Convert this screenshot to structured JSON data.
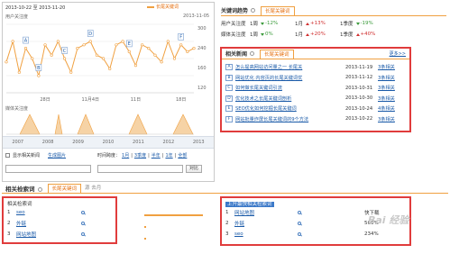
{
  "chart": {
    "date_range": "2013-10-22 至 2013-11-20",
    "legend_keyword": "长尾关键词",
    "end_date": "2013-11-05",
    "user_index_label": "用户关注度",
    "media_index_label": "媒体关注度",
    "point_markers": [
      "A",
      "B",
      "C",
      "D",
      "E",
      "F"
    ],
    "x_ticks": [
      "28日",
      "11月4日",
      "11日",
      "18日"
    ],
    "y_ticks": [
      "300",
      "240",
      "160",
      "120"
    ],
    "timeline_years": [
      "2007",
      "2008",
      "2009",
      "2010",
      "2011",
      "2012",
      "2013"
    ],
    "show_related_news": "显示相关新闻",
    "generate_image": "生成图片",
    "time_span_label": "时间跨度：",
    "span_options": [
      "1月",
      "3季度",
      "半年",
      "1年",
      "全部"
    ],
    "compare_button": "对比"
  },
  "chart_data": {
    "type": "line",
    "title": "",
    "series": [
      {
        "name": "长尾关键词",
        "values": [
          190,
          250,
          160,
          230,
          200,
          150,
          240,
          210,
          250,
          200,
          160,
          230,
          240,
          250,
          210,
          200,
          170,
          240,
          250,
          220,
          180,
          240,
          230,
          210,
          190,
          250,
          200,
          240,
          220,
          230
        ]
      }
    ],
    "ylim": [
      100,
      300
    ],
    "grid": true
  },
  "trend": {
    "title": "关键词趋势",
    "tab": "长尾关键词",
    "rows": [
      {
        "label": "用户关注度",
        "cells": [
          {
            "period": "1周",
            "dir": "down",
            "val": "-12%"
          },
          {
            "period": "1月",
            "dir": "up",
            "val": "+13%"
          },
          {
            "period": "1季度",
            "dir": "down",
            "val": "-19%"
          }
        ]
      },
      {
        "label": "媒体关注度",
        "cells": [
          {
            "period": "1周",
            "dir": "down",
            "val": "0%"
          },
          {
            "period": "1月",
            "dir": "up",
            "val": "+20%"
          },
          {
            "period": "1季度",
            "dir": "up",
            "val": "+40%"
          }
        ]
      }
    ]
  },
  "news": {
    "title": "相关新闻",
    "tab": "长尾关键词",
    "more": "更多>>",
    "items": [
      {
        "num": "A",
        "title": "怎么提高网站访问量之一 长尾关",
        "date": "2013-11-19",
        "link": "3条相关"
      },
      {
        "num": "B",
        "title": "网站优化 内容页的长尾关键词优",
        "date": "2013-11-12",
        "link": "3条相关"
      },
      {
        "num": "C",
        "title": "如何做长尾关键词引流",
        "date": "2013-10-31",
        "link": "3条相关"
      },
      {
        "num": "D",
        "title": "优化技术之长尾关键词剖析",
        "date": "2013-10-30",
        "link": "3条相关"
      },
      {
        "num": "E",
        "title": "SEO优化如何挖掘长尾关键词",
        "date": "2013-10-24",
        "link": "4条相关"
      },
      {
        "num": "F",
        "title": "网站批量炸屏长尾关键词的9个方法",
        "date": "2013-10-22",
        "link": "3条相关"
      }
    ]
  },
  "related": {
    "title": "相关检索词",
    "tab": "长尾关键词",
    "tab2": "源 去月",
    "left_header": "相关检索词",
    "left_items": [
      {
        "num": "1",
        "term": "seo"
      },
      {
        "num": "2",
        "term": "外链"
      },
      {
        "num": "3",
        "term": "网站地图"
      }
    ],
    "right_header": "上升最快相关检索词",
    "right_items": [
      {
        "num": "1",
        "term": "网站地图",
        "value": "快下载"
      },
      {
        "num": "2",
        "term": "外链",
        "value": "566%"
      },
      {
        "num": "3",
        "term": "seo",
        "value": "234%"
      }
    ]
  },
  "watermark": "Bai 经验"
}
